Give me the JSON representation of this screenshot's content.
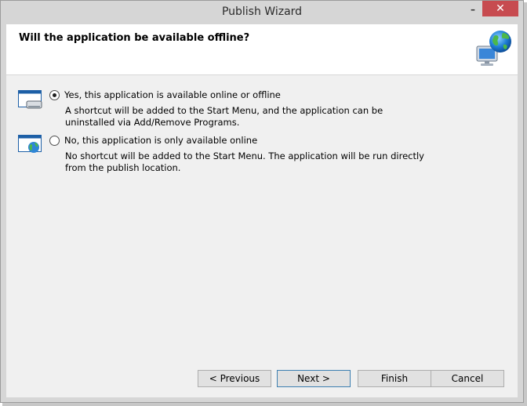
{
  "window": {
    "title": "Publish Wizard",
    "minimize_glyph": "–",
    "close_glyph": "✕"
  },
  "header": {
    "title": "Will the application be available offline?",
    "icon": "globe-computer-icon"
  },
  "options": [
    {
      "label": "Yes, this application is available online or offline",
      "description": "A shortcut will be added to the Start Menu, and the application can be uninstalled via Add/Remove Programs.",
      "selected": true,
      "icon": "offline-app-icon"
    },
    {
      "label": "No, this application is only available online",
      "description": "No shortcut will be added to the Start Menu. The application will be run directly from the publish location.",
      "selected": false,
      "icon": "online-app-icon"
    }
  ],
  "buttons": {
    "previous": "< Previous",
    "next": "Next >",
    "finish": "Finish",
    "cancel": "Cancel"
  },
  "colors": {
    "close_button": "#c74b50",
    "default_button_border": "#3c7fb1",
    "window_frame": "#d6d6d6",
    "client_background": "#f0f0f0"
  }
}
